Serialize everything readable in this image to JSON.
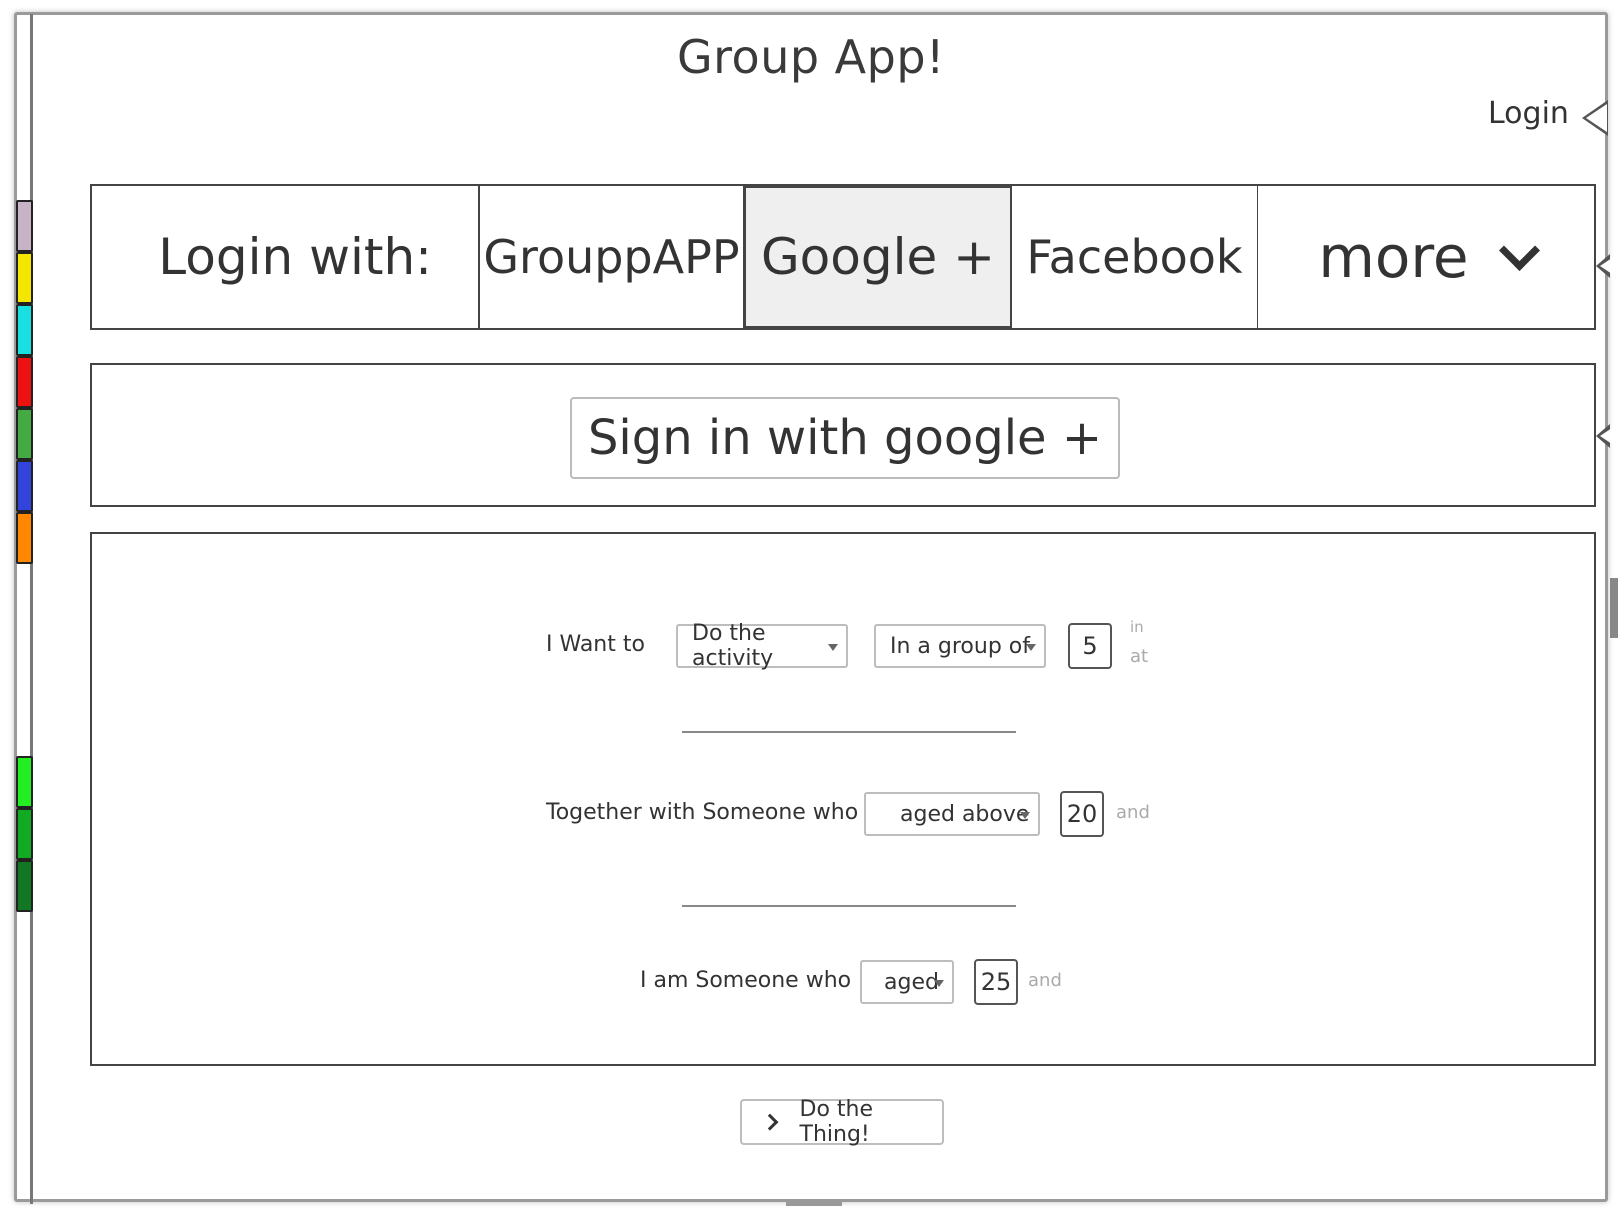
{
  "app": {
    "title": "Group App!",
    "login_link": "Login"
  },
  "palette": [
    "#c6b3c6",
    "#f5e600",
    "#19e0e0",
    "#ee1111",
    "#44aa44",
    "#3344dd",
    "#ff8800",
    "#22ee22",
    "#11aa22",
    "#117722"
  ],
  "login_tabs": {
    "label": "Login with:",
    "options": [
      "GrouppAPP",
      "Google +",
      "Facebook",
      "more"
    ],
    "selected": "Google +"
  },
  "signin": {
    "button_label": "Sign in with google +"
  },
  "form": {
    "row1": {
      "prefix": "I  Want to",
      "activity": "Do the activity",
      "group": "In a group of",
      "count": "5",
      "tail_top": "in",
      "tail_bottom": "at"
    },
    "row2": {
      "prefix": "Together with Someone  who is",
      "age_rule": "aged above",
      "age": "20",
      "tail": "and"
    },
    "row3": {
      "prefix": "I am Someone  who is",
      "age_rule": "aged",
      "age": "25",
      "tail": "and"
    }
  },
  "submit": {
    "label": "Do the Thing!"
  },
  "icons": [
    "chevron-down-icon",
    "chevron-right-icon",
    "collapse-arrow-icon"
  ]
}
